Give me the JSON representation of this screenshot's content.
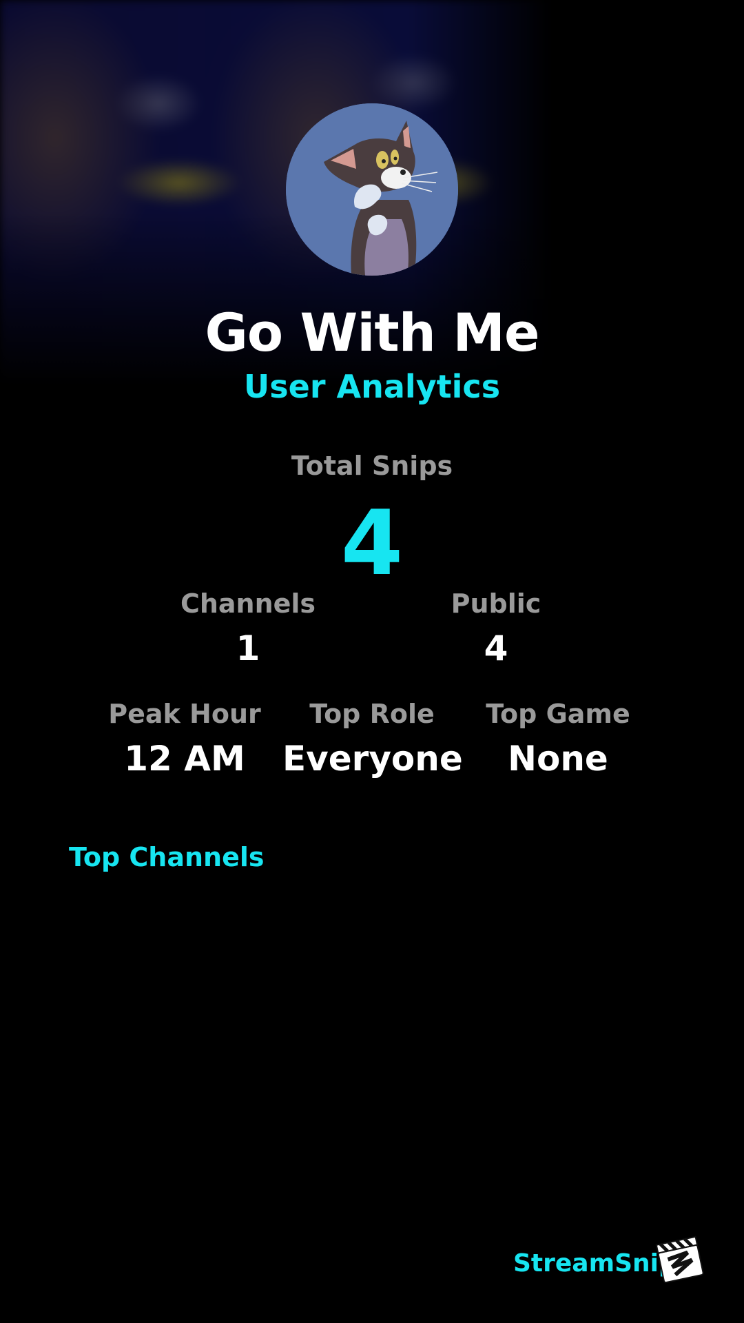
{
  "profile": {
    "name": "Go With Me",
    "subtitle": "User Analytics"
  },
  "stats": {
    "total_snips": {
      "label": "Total Snips",
      "value": "4"
    },
    "channels": {
      "label": "Channels",
      "value": "1"
    },
    "public": {
      "label": "Public",
      "value": "4"
    },
    "peak_hour": {
      "label": "Peak Hour",
      "value": "12 AM"
    },
    "top_role": {
      "label": "Top Role",
      "value": "Everyone"
    },
    "top_game": {
      "label": "Top Game",
      "value": "None"
    }
  },
  "sections": {
    "top_channels": "Top Channels"
  },
  "footer": {
    "brand": "StreamSnip",
    "logo_icon": "clapperboard-icon"
  },
  "colors": {
    "accent": "#17e5f1",
    "label_gray": "#9a9a9a",
    "background": "#000000"
  }
}
